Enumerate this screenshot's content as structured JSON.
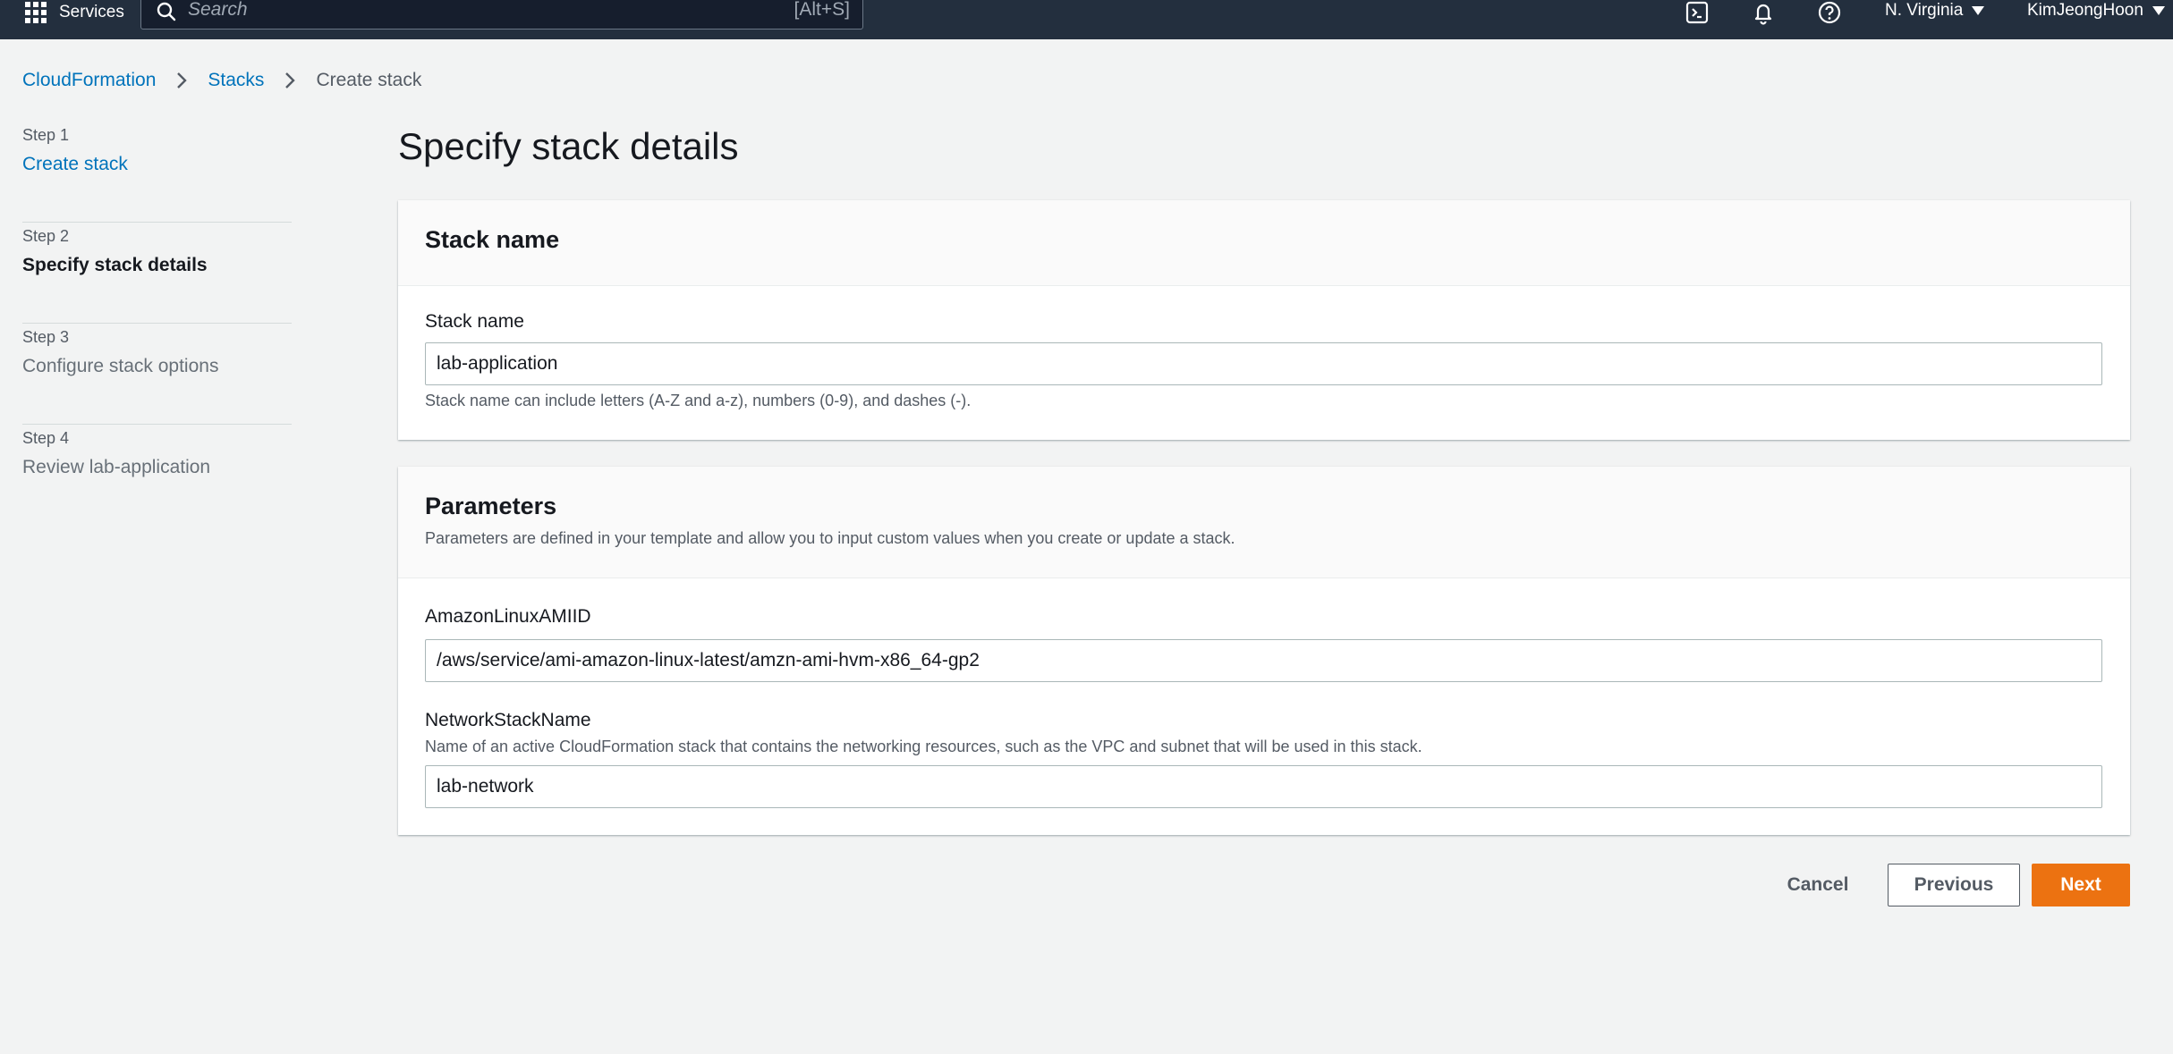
{
  "topnav": {
    "services_label": "Services",
    "search_placeholder": "Search",
    "search_shortcut": "[Alt+S]",
    "region": "N. Virginia",
    "user": "KimJeongHoon"
  },
  "breadcrumb": {
    "items": [
      "CloudFormation",
      "Stacks",
      "Create stack"
    ]
  },
  "steps": [
    {
      "number": "Step 1",
      "title": "Create stack"
    },
    {
      "number": "Step 2",
      "title": "Specify stack details"
    },
    {
      "number": "Step 3",
      "title": "Configure stack options"
    },
    {
      "number": "Step 4",
      "title": "Review lab-application"
    }
  ],
  "page_title": "Specify stack details",
  "stack_name_panel": {
    "header": "Stack name",
    "label": "Stack name",
    "value": "lab-application",
    "hint": "Stack name can include letters (A-Z and a-z), numbers (0-9), and dashes (-)."
  },
  "parameters_panel": {
    "header": "Parameters",
    "description": "Parameters are defined in your template and allow you to input custom values when you create or update a stack.",
    "ami_label": "AmazonLinuxAMIID",
    "ami_value": "/aws/service/ami-amazon-linux-latest/amzn-ami-hvm-x86_64-gp2",
    "network_label": "NetworkStackName",
    "network_desc": "Name of an active CloudFormation stack that contains the networking resources, such as the VPC and subnet that will be used in this stack.",
    "network_value": "lab-network"
  },
  "buttons": {
    "cancel": "Cancel",
    "previous": "Previous",
    "next": "Next"
  },
  "colors": {
    "nav_bg": "#232f3e",
    "link": "#0073bb",
    "primary_button": "#ec7211",
    "page_bg": "#f2f3f3"
  }
}
